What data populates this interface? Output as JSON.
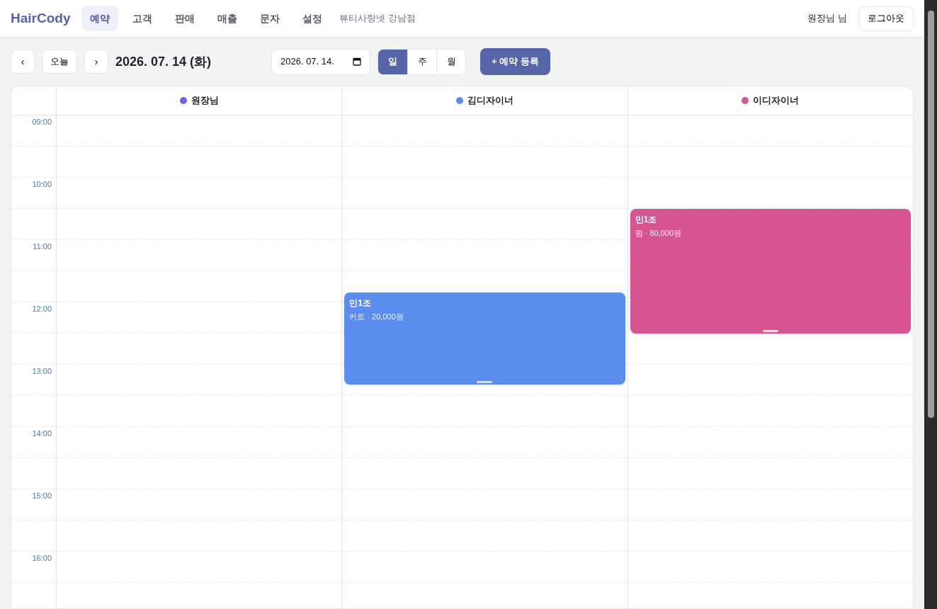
{
  "brand": "HairCody",
  "nav": [
    {
      "label": "예약",
      "selected": true
    },
    {
      "label": "고객",
      "selected": false
    },
    {
      "label": "판매",
      "selected": false
    },
    {
      "label": "매출",
      "selected": false
    },
    {
      "label": "문자",
      "selected": false
    },
    {
      "label": "설정",
      "selected": false
    }
  ],
  "shop_name": "뷰티사랑넷 강남점",
  "user": "원장님 님",
  "logout": "로그아웃",
  "toolbar": {
    "prev": "‹",
    "today": "오늘",
    "next": "›",
    "date_title": "2026. 07. 14 (화)",
    "date_field": "2026. 07. 14.",
    "views": [
      {
        "label": "일",
        "selected": true
      },
      {
        "label": "주",
        "selected": false
      },
      {
        "label": "월",
        "selected": false
      }
    ],
    "add_button": "+ 예약 등록"
  },
  "times": [
    "09:00",
    "10:00",
    "11:00",
    "12:00",
    "13:00",
    "14:00",
    "15:00",
    "16:00"
  ],
  "staff": [
    {
      "name": "원장님",
      "color": "#7c5cf0"
    },
    {
      "name": "김디자이너",
      "color": "#5b8def",
      "appointments": [
        {
          "customer": "민1조",
          "detail": "커트 · 20,000원"
        }
      ]
    },
    {
      "name": "이디자이너",
      "color": "#d65591",
      "appointments": [
        {
          "customer": "민1조",
          "detail": "펌 · 80,000원"
        }
      ]
    }
  ]
}
